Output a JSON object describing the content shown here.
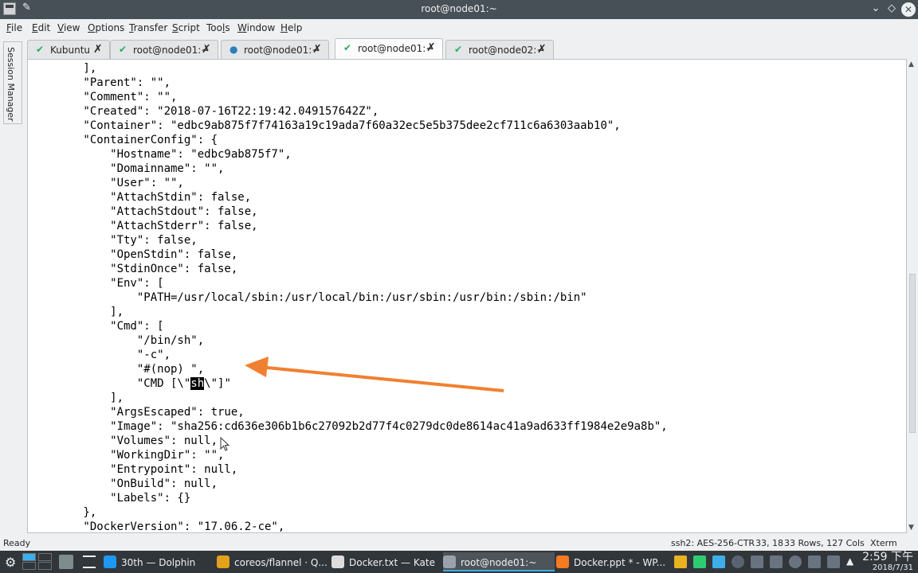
{
  "window": {
    "title": "root@node01:~"
  },
  "menu": [
    {
      "label": "File",
      "u": "F"
    },
    {
      "label": "Edit",
      "u": "E"
    },
    {
      "label": "View",
      "u": "V"
    },
    {
      "label": "Options",
      "u": "O"
    },
    {
      "label": "Transfer",
      "u": "T"
    },
    {
      "label": "Script",
      "u": "S"
    },
    {
      "label": "Tools",
      "u": "l"
    },
    {
      "label": "Window",
      "u": "W"
    },
    {
      "label": "Help",
      "u": "H"
    }
  ],
  "tabs": [
    {
      "label": "Kubuntu",
      "status": "connected"
    },
    {
      "label": "root@node01:~",
      "status": "connected"
    },
    {
      "label": "root@node01:~",
      "status": "info"
    },
    {
      "label": "root@node01:~",
      "status": "connected",
      "active": true
    },
    {
      "label": "root@node02:~",
      "status": "connected"
    }
  ],
  "sidebar": {
    "label": "Session Manager"
  },
  "terminal": {
    "lines": [
      "        ],",
      "        \"Parent\": \"\",",
      "        \"Comment\": \"\",",
      "        \"Created\": \"2018-07-16T22:19:42.049157642Z\",",
      "        \"Container\": \"edbc9ab875f7f74163a19c19ada7f60a32ec5e5b375dee2cf711c6a6303aab10\",",
      "        \"ContainerConfig\": {",
      "            \"Hostname\": \"edbc9ab875f7\",",
      "            \"Domainname\": \"\",",
      "            \"User\": \"\",",
      "            \"AttachStdin\": false,",
      "            \"AttachStdout\": false,",
      "            \"AttachStderr\": false,",
      "            \"Tty\": false,",
      "            \"OpenStdin\": false,",
      "            \"StdinOnce\": false,",
      "            \"Env\": [",
      "                \"PATH=/usr/local/sbin:/usr/local/bin:/usr/sbin:/usr/bin:/sbin:/bin\"",
      "            ],",
      "            \"Cmd\": [",
      "                \"/bin/sh\",",
      "                \"-c\",",
      "                \"#(nop) \",",
      "                \"CMD [\\\"sh\\\"]\"",
      "            ],",
      "            \"ArgsEscaped\": true,",
      "            \"Image\": \"sha256:cd636e306b1b6c27092b2d77f4c0279dc0de8614ac41a9ad633ff1984e2e9a8b\",",
      "            \"Volumes\": null,",
      "            \"WorkingDir\": \"\",",
      "            \"Entrypoint\": null,",
      "            \"OnBuild\": null,",
      "            \"Labels\": {}",
      "        },",
      "        \"DockerVersion\": \"17.06.2-ce\","
    ],
    "selected_text": "sh",
    "selected_line": 22
  },
  "status": {
    "ready": "Ready",
    "cipher": "ssh2: AES-256-CTR",
    "cursor": "33, 18",
    "size": "33 Rows, 127 Cols",
    "term_type": "Xterm"
  },
  "taskbar": {
    "tasks": [
      {
        "label": "30th — Dolphin",
        "color": "#1d99f3"
      },
      {
        "label": "coreos/flannel · Q...",
        "color": "#e3a21a"
      },
      {
        "label": "Docker.txt — Kate",
        "color": "#dcdcdc"
      },
      {
        "label": "root@node01:~",
        "color": "#9aa3ab",
        "active": true
      },
      {
        "label": "Docker.ppt * - WP...",
        "color": "#f47b20"
      }
    ],
    "clock_time": "2:59 下午",
    "clock_date": "2018/7/31"
  },
  "colors": {
    "arrow": "#f08030",
    "selection": "#000000",
    "taskbar": "#31363b",
    "titlebar": "#475057"
  }
}
